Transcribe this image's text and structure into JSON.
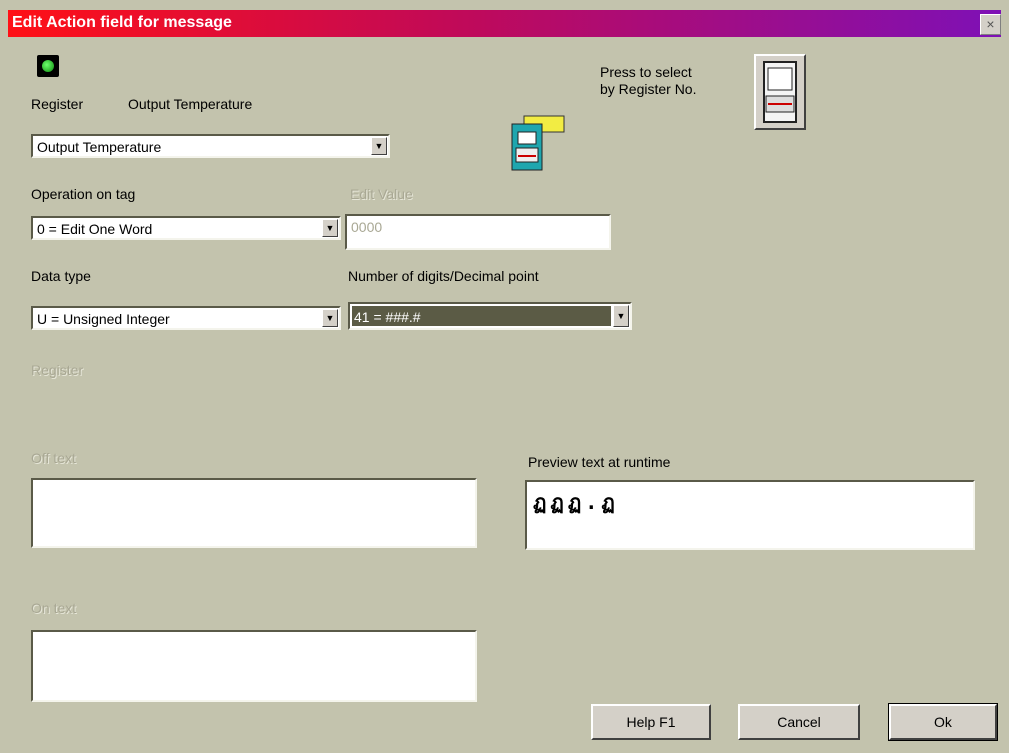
{
  "window": {
    "title": "Edit Action field for message",
    "close_glyph": "×"
  },
  "register": {
    "label": "Register",
    "current_name": "Output Temperature",
    "selected": "Output Temperature"
  },
  "register_select": {
    "caption_line1": "Press to select",
    "caption_line2": "by Register No."
  },
  "operation": {
    "label": "Operation on tag",
    "selected": "0 = Edit One Word"
  },
  "edit_value": {
    "label": "Edit Value",
    "value": "0000"
  },
  "data_type": {
    "label": "Data type",
    "selected": "U = Unsigned Integer"
  },
  "digits": {
    "label": "Number of digits/Decimal point",
    "selected": "41 = ###.#"
  },
  "disabled_labels": {
    "register_value": "Register",
    "off_text": "Off text",
    "on_text": "On text"
  },
  "preview": {
    "label": "Preview text at runtime",
    "text": "ฏฏฏ.ฏ"
  },
  "buttons": {
    "help": "Help  F1",
    "cancel": "Cancel",
    "ok": "Ok"
  },
  "icons": {
    "led": "status-led-icon",
    "tag_browse": "tag-browse-icon",
    "register_number": "register-number-icon"
  }
}
